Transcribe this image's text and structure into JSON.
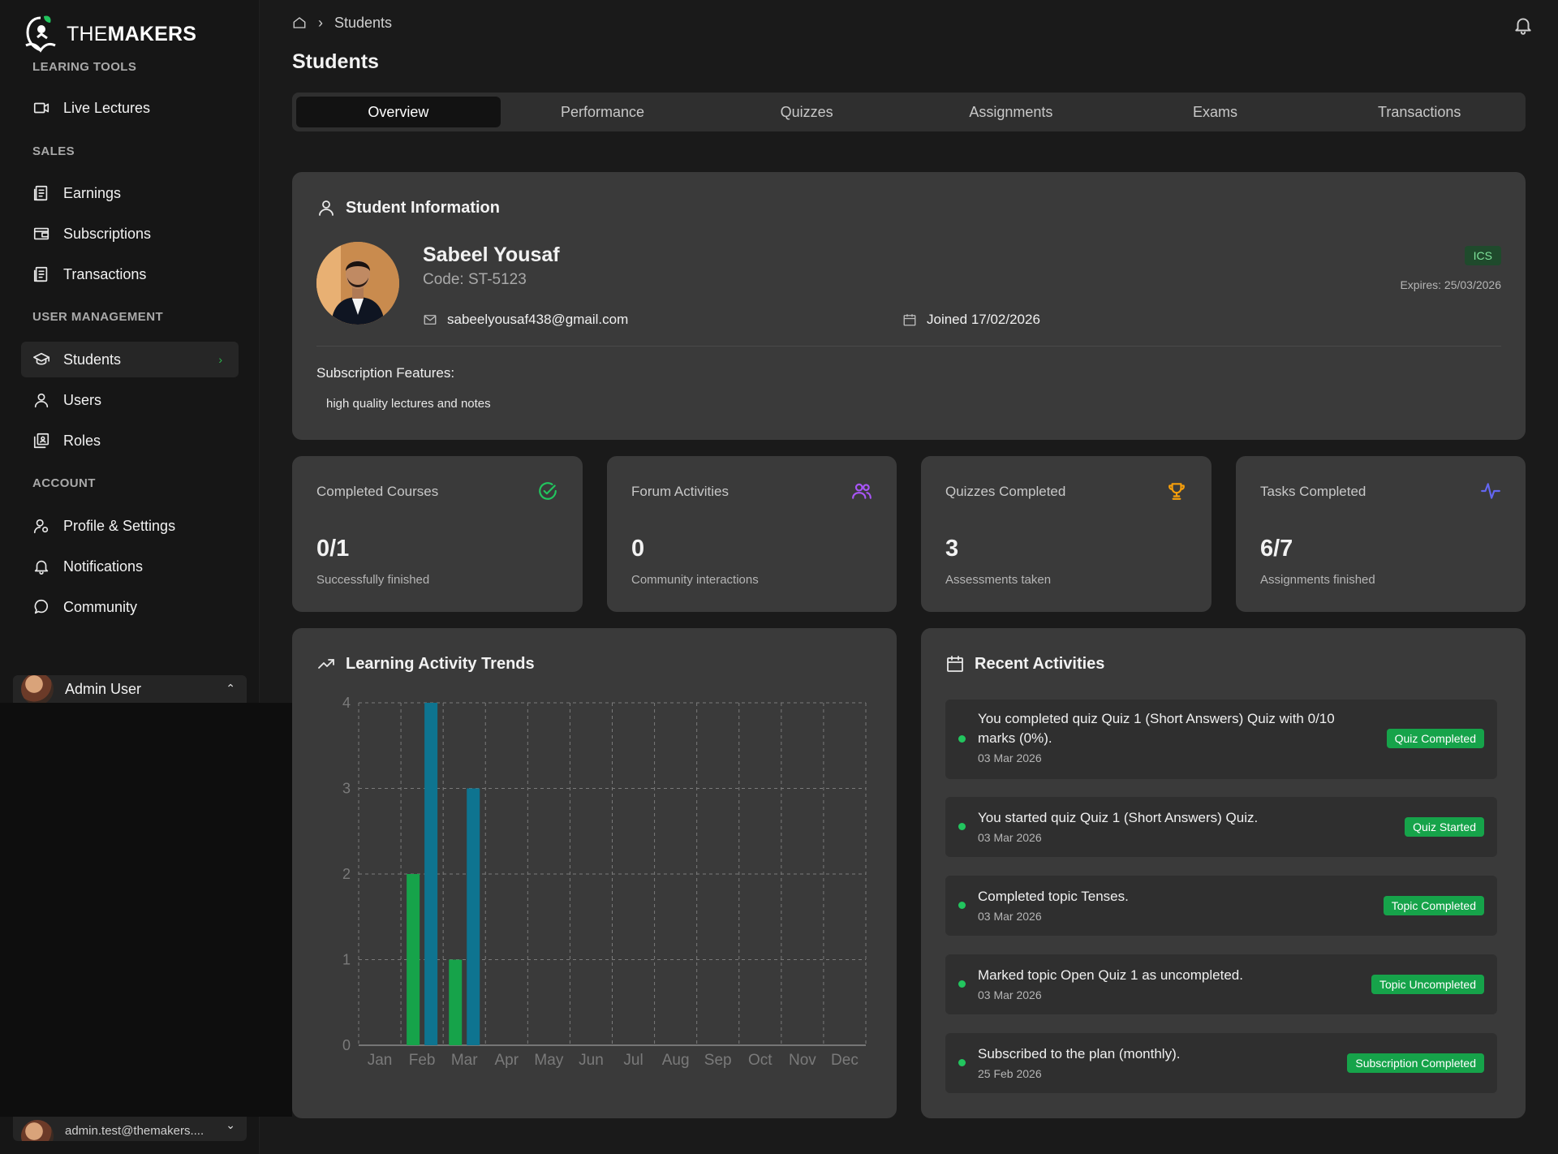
{
  "brand": {
    "prefix": "THE",
    "name": "MAKERS"
  },
  "sidebar": {
    "sections": [
      {
        "label": "LEARING TOOLS"
      },
      {
        "label": "SALES"
      },
      {
        "label": "USER MANAGEMENT"
      },
      {
        "label": "ACCOUNT"
      }
    ],
    "items": [
      {
        "label": "Live Lectures",
        "icon": "video-icon"
      },
      {
        "label": "Earnings",
        "icon": "receipt-icon"
      },
      {
        "label": "Subscriptions",
        "icon": "wallet-icon"
      },
      {
        "label": "Transactions",
        "icon": "receipt-icon"
      },
      {
        "label": "Students",
        "icon": "graduation-cap-icon",
        "active": true
      },
      {
        "label": "Users",
        "icon": "user-icon"
      },
      {
        "label": "Roles",
        "icon": "roles-icon"
      },
      {
        "label": "Profile & Settings",
        "icon": "user-cog-icon"
      },
      {
        "label": "Notifications",
        "icon": "bell-icon"
      },
      {
        "label": "Community",
        "icon": "chat-bubble-icon"
      }
    ],
    "user": {
      "name": "Admin User",
      "email": "admin.test@themakers...."
    }
  },
  "breadcrumb": {
    "current": "Students"
  },
  "page": {
    "title": "Students"
  },
  "tabs": [
    "Overview",
    "Performance",
    "Quizzes",
    "Assignments",
    "Exams",
    "Transactions"
  ],
  "student": {
    "section_title": "Student Information",
    "name": "Sabeel Yousaf",
    "code": "Code: ST-5123",
    "email": "sabeelyousaf438@gmail.com",
    "joined": "Joined 17/02/2026",
    "plan_badge": "ICS",
    "expires": "Expires: 25/03/2026",
    "features_title": "Subscription Features:",
    "features": [
      "high quality lectures and notes"
    ]
  },
  "stats": [
    {
      "label": "Completed Courses",
      "value": "0/1",
      "sub": "Successfully finished",
      "icon": "check-circle-icon",
      "color": "#22c55e"
    },
    {
      "label": "Forum Activities",
      "value": "0",
      "sub": "Community interactions",
      "icon": "users-icon",
      "color": "#a855f7"
    },
    {
      "label": "Quizzes Completed",
      "value": "3",
      "sub": "Assessments taken",
      "icon": "trophy-icon",
      "color": "#f59e0b"
    },
    {
      "label": "Tasks Completed",
      "value": "6/7",
      "sub": "Assignments finished",
      "icon": "activity-icon",
      "color": "#6366f1"
    }
  ],
  "trends": {
    "title": "Learning Activity Trends"
  },
  "chart_data": {
    "type": "bar",
    "categories": [
      "Jan",
      "Feb",
      "Mar",
      "Apr",
      "May",
      "Jun",
      "Jul",
      "Aug",
      "Sep",
      "Oct",
      "Nov",
      "Dec"
    ],
    "series": [
      {
        "values": [
          0,
          2,
          1,
          0,
          0,
          0,
          0,
          0,
          0,
          0,
          0,
          0
        ],
        "color": "#16a34a"
      },
      {
        "values": [
          0,
          4,
          3,
          0,
          0,
          0,
          0,
          0,
          0,
          0,
          0,
          0
        ],
        "color": "#0e7490"
      }
    ],
    "yticks": [
      "0",
      "1",
      "2",
      "3",
      "4"
    ],
    "ylim": [
      0,
      4
    ],
    "grid": true
  },
  "recent": {
    "title": "Recent Activities",
    "items": [
      {
        "text": "You completed quiz Quiz 1 (Short Answers) Quiz with 0/10 marks (0%).",
        "date": "03 Mar 2026",
        "badge": "Quiz Completed"
      },
      {
        "text": "You started quiz Quiz 1 (Short Answers) Quiz.",
        "date": "03 Mar 2026",
        "badge": "Quiz Started"
      },
      {
        "text": "Completed topic Tenses.",
        "date": "03 Mar 2026",
        "badge": "Topic Completed"
      },
      {
        "text": "Marked topic Open Quiz 1 as uncompleted.",
        "date": "03 Mar 2026",
        "badge": "Topic Uncompleted"
      },
      {
        "text": "Subscribed to the plan (monthly).",
        "date": "25 Feb 2026",
        "badge": "Subscription Completed"
      }
    ]
  }
}
